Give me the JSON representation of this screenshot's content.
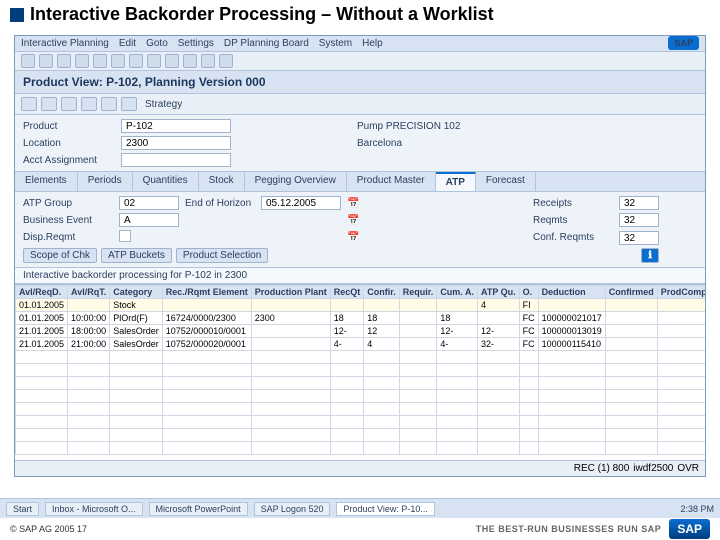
{
  "slide": {
    "title": "Interactive Backorder Processing – Without a Worklist",
    "copyright": "© SAP AG 2005  17",
    "tagline": "THE BEST-RUN BUSINESSES RUN SAP",
    "sap": "SAP"
  },
  "menubar": {
    "items": [
      "Interactive Planning",
      "Edit",
      "Goto",
      "Settings",
      "DP Planning Board",
      "System",
      "Help"
    ]
  },
  "view_title": "Product View: P-102, Planning Version 000",
  "toolbar": {
    "strategy": "Strategy"
  },
  "form": {
    "product_lbl": "Product",
    "product_val": "P-102",
    "desc": "Pump PRECISION 102",
    "location_lbl": "Location",
    "location_val": "2300",
    "loc_desc": "Barcelona",
    "acct_lbl": "Acct Assignment"
  },
  "tabs": {
    "items": [
      "Elements",
      "Periods",
      "Quantities",
      "Stock",
      "Pegging Overview",
      "Product Master",
      "ATP",
      "Forecast"
    ],
    "active": 6
  },
  "atp": {
    "group_lbl": "ATP Group",
    "group_val": "02",
    "end_lbl": "End of Horizon",
    "end_val": "05.12.2005",
    "bh_lbl": "Business Event",
    "bh_val": "A",
    "cum_lbl": "Disp.Reqmt",
    "cum_chk": true,
    "req_lbl": "Receipts",
    "req_val": "32",
    "rqs_lbl": "Reqmts",
    "rqs_val": "32",
    "conf_lbl": "Conf. Reqmts",
    "conf_val": "32",
    "btn_scope": "Scope of Chk",
    "btn_rules": "ATP Buckets",
    "btn_prodsel": "Product Selection"
  },
  "subhdr": "Interactive backorder processing for P-102 in 2300",
  "grid": {
    "cols": [
      "AvI/ReqD.",
      "AvI/RqT.",
      "Category",
      "Rec./Rqmt Element",
      "Production Plant",
      "RecQt",
      "Confir.",
      "Requir.",
      "Cum. A.",
      "ATP Qu.",
      "O.",
      "Deduction",
      "Confirmed",
      "ProdCompDate"
    ],
    "rows": [
      {
        "cls": "stock",
        "c": [
          "01.01.2005",
          "",
          "Stock",
          "",
          "",
          "",
          "",
          "",
          "",
          "4",
          "FI",
          "",
          "",
          ""
        ]
      },
      {
        "cls": "",
        "c": [
          "01.01.2005",
          "10:00:00",
          "PlOrd(F)",
          "16724/0000/2300",
          "2300",
          "18",
          "18",
          "",
          "18",
          "",
          "FC",
          "100000021017",
          "",
          ""
        ]
      },
      {
        "cls": "",
        "c": [
          "21.01.2005",
          "18:00:00",
          "SalesOrder",
          "10752/000010/0001",
          "",
          "12-",
          "12",
          "",
          "12-",
          "12-",
          "FC",
          "100000013019",
          "",
          ""
        ]
      },
      {
        "cls": "",
        "c": [
          "21.01.2005",
          "21:00:00",
          "SalesOrder",
          "10752/000020/0001",
          "",
          "4-",
          "4",
          "",
          "4-",
          "32-",
          "FC",
          "100000115410",
          "",
          ""
        ]
      }
    ]
  },
  "statusbar": {
    "rec": "REC (1) 800",
    "host": "iwdf2500",
    "ovr": "OVR"
  },
  "taskbar": {
    "start": "Start",
    "items": [
      "Inbox - Microsoft O...",
      "Microsoft PowerPoint"
    ],
    "sap_session": "SAP Logon 520",
    "active": "Product View: P-10...",
    "time": "2:38 PM"
  }
}
